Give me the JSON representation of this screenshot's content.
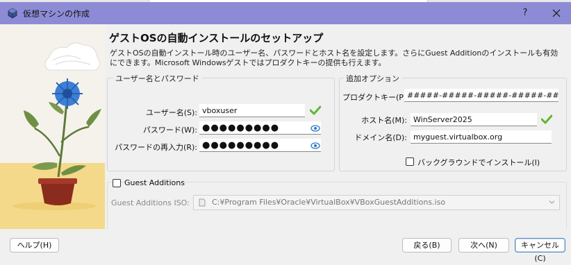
{
  "window": {
    "title": "仮想マシンの作成",
    "help_glyph": "?"
  },
  "page": {
    "heading": "ゲストOSの自動インストールのセットアップ",
    "description_line1": "ゲストOSの自動インストール時のユーザー名、パスワードとホスト名を設定します。さらにGuest Additionのインストールも有効",
    "description_line2": "にできます。Microsoft Windowsゲストではプロダクトキーの提供も行えます。"
  },
  "user_group": {
    "legend": "ユーザー名とパスワード",
    "username_label": "ユーザー名(S):",
    "username_value": "vboxuser",
    "password_label": "パスワード(W):",
    "password_value": "●●●●●●●●●",
    "password_repeat_label": "パスワードの再入力(R):",
    "password_repeat_value": "●●●●●●●●●"
  },
  "options_group": {
    "legend": "追加オプション",
    "product_key_label": "プロダクトキー(P):",
    "product_key_value": "#####-#####-#####-#####-#####",
    "hostname_label": "ホスト名(M):",
    "hostname_value": "WinServer2025",
    "domain_label": "ドメイン名(D):",
    "domain_value": "myguest.virtualbox.org",
    "background_install_label": "バックグラウンドでインストール(I)",
    "background_install_checked": false
  },
  "guest_additions": {
    "checkbox_label": "Guest Additions",
    "checked": false,
    "iso_label": "Guest Additions ISO:",
    "iso_value": "C:¥Program Files¥Oracle¥VirtualBox¥VBoxGuestAdditions.iso"
  },
  "buttons": {
    "help": "ヘルプ(H)",
    "back": "戻る(B)",
    "next": "次へ(N)",
    "cancel": "キャンセル(C)"
  },
  "colors": {
    "titlebar": "#8e8bd6",
    "valid_check": "#5cb82e",
    "eye_icon": "#2a74c9",
    "flower": "#3c7fd6",
    "pot": "#8b2b1e"
  }
}
